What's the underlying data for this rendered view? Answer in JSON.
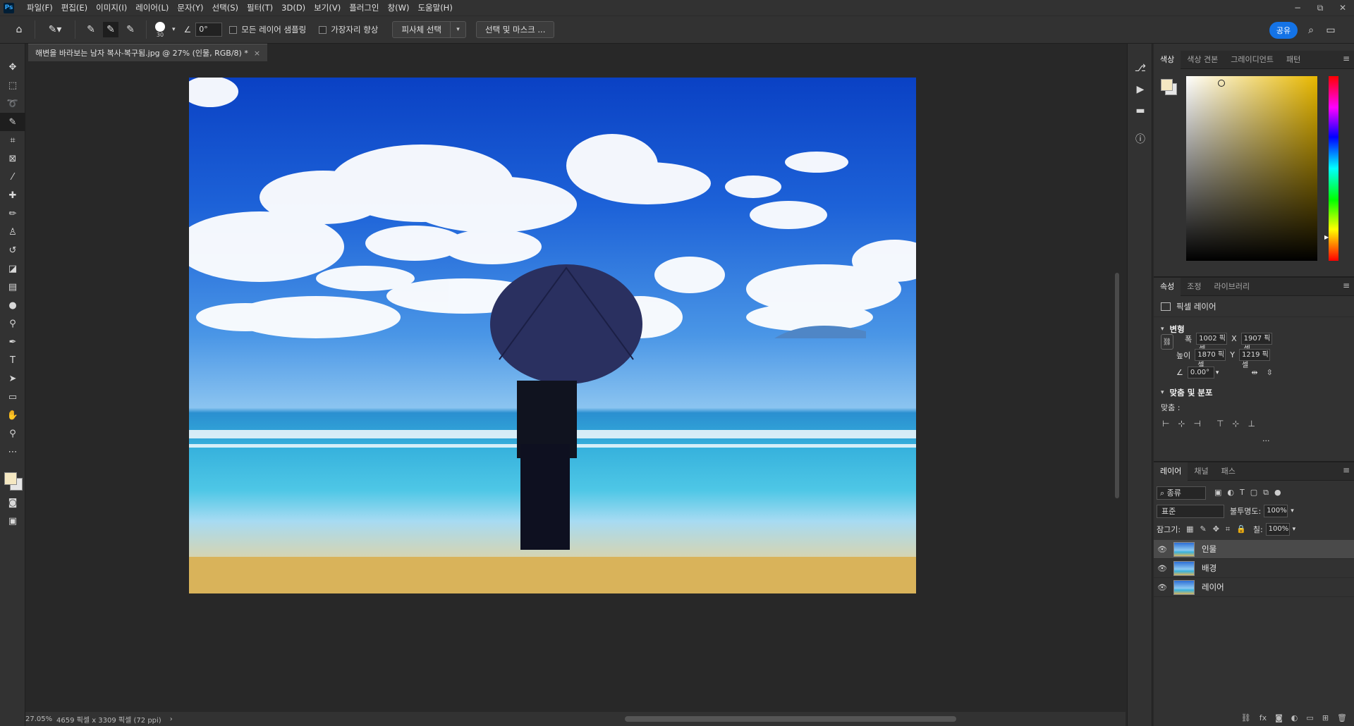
{
  "app": {
    "logo": "Ps"
  },
  "menu": [
    "파일(F)",
    "편집(E)",
    "이미지(I)",
    "레이어(L)",
    "문자(Y)",
    "선택(S)",
    "필터(T)",
    "3D(D)",
    "보기(V)",
    "플러그인",
    "창(W)",
    "도움말(H)"
  ],
  "window": {
    "minimize": "−",
    "restore": "⧉",
    "close": "✕"
  },
  "options": {
    "brush_size": "30",
    "angle_value": "0°",
    "sample_all_layers_label": "모든 레이어 샘플링",
    "enhance_edge_label": "가장자리 향상",
    "select_subject_label": "피사체 선택",
    "select_mask_label": "선택 및 마스크 ...",
    "share_label": "공유"
  },
  "document": {
    "tab_title": "해변을 바라보는 남자 복사-복구됨.jpg @ 27% (인물, RGB/8) *",
    "zoom": "27.05%",
    "doc_info": "4659 픽셀 x 3309 픽셀 (72 ppi)"
  },
  "color_panel": {
    "tabs": [
      "색상",
      "색상 견본",
      "그레이디언트",
      "패턴"
    ],
    "foreground_color": "#f5e8c2",
    "background_color": "#e6e6e6"
  },
  "properties_panel": {
    "tabs": [
      "속성",
      "조정",
      "라이브러리"
    ],
    "layer_type": "픽셀 레이어",
    "transform_header": "변형",
    "width_label": "폭",
    "width_value": "1002 픽셀",
    "height_label": "높이",
    "height_value": "1870 픽셀",
    "x_label": "X",
    "x_value": "1907 픽셀",
    "y_label": "Y",
    "y_value": "1219 픽셀",
    "angle_value": "0.00°",
    "align_header": "맞춤 및 분포",
    "align_label": "맞춤 :",
    "more": "..."
  },
  "layers_panel": {
    "tabs": [
      "레이어",
      "채널",
      "패스"
    ],
    "filter_label": "종류",
    "blend_mode": "표준",
    "opacity_label": "불투명도:",
    "opacity_value": "100%",
    "lock_label": "잠그기:",
    "fill_label": "칠:",
    "fill_value": "100%",
    "layers": [
      {
        "name": "인물",
        "selected": true
      },
      {
        "name": "배경",
        "selected": false
      },
      {
        "name": "레이어",
        "selected": false
      }
    ]
  }
}
